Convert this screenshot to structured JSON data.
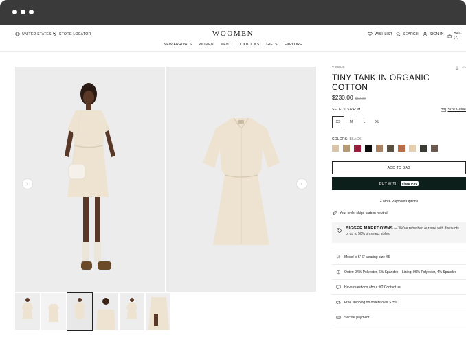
{
  "header": {
    "region": "UNITED STATES",
    "store_locator": "STORE LOCATOR",
    "logo": "WOOMEN",
    "wishlist": "WISHLIST",
    "search": "SEARCH",
    "sign_in": "SIGN IN",
    "bag": "BAG (2)"
  },
  "nav": [
    "NEW ARRIVALS",
    "WOMEN",
    "MEN",
    "LOOKBOOKS",
    "GIFTS",
    "EXPLORE"
  ],
  "product": {
    "brand": "VOGUE",
    "title": "TINY TANK IN ORGANIC COTTON",
    "price": "$230.00",
    "old_price": "$69.95",
    "size_label": "SELECT SIZE: M",
    "size_guide": "Size Guide",
    "sizes": [
      "XS",
      "M",
      "L",
      "XL"
    ],
    "colors_label": "COLORS:",
    "colors_value": "BLACK",
    "swatch_colors": [
      "#d9c6a8",
      "#b89b74",
      "#9a1d3c",
      "#0b0b0b",
      "#a98160",
      "#5a5040",
      "#b66a45",
      "#e4cfb0",
      "#3b3b35",
      "#6b5a52"
    ],
    "add_to_bag": "ADD TO BAG",
    "buy_with": "BUY WITH",
    "shop_pay": "shop Pay",
    "more_payment": "+ More Payment Options",
    "carbon": "Your order ships carbon neutral",
    "promo_title": "BIGGER MARKDOWNS",
    "promo_text": " — We've refreshed our sale with discounts of up to 50% on select styles.",
    "info": [
      "Model is 5' 6\" wearing size XS",
      "Outer: 94% Polyester, 6% Spandex – Lining: 96% Polyester, 4% Spandex",
      "Have questions about fit? Contact us",
      "Free shipping on orders over $250",
      "Secure payment"
    ]
  },
  "colors": {
    "accent": "#0d1f1a",
    "dress": "#ede3d0",
    "chrome": "#3a3a3a"
  },
  "icons": [
    "globe-icon",
    "location-icon",
    "heart-icon",
    "search-icon",
    "user-icon",
    "bag-icon",
    "share-icon",
    "star-icon",
    "ruler-icon",
    "leaf-icon",
    "tag-icon",
    "hanger-icon",
    "fabric-icon",
    "chat-icon",
    "truck-icon",
    "card-icon"
  ]
}
